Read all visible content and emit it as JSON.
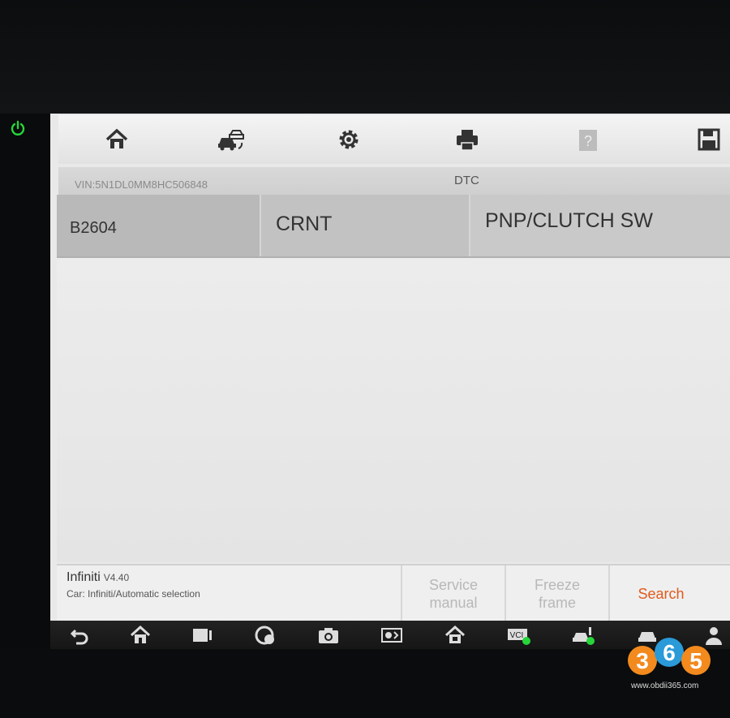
{
  "toolbar": {
    "icons": [
      "home-icon",
      "vehicle-swap-icon",
      "gear-icon",
      "printer-icon",
      "help-icon",
      "save-icon"
    ]
  },
  "info": {
    "vin": "VIN:5N1DL0MM8HC506848",
    "title": "DTC"
  },
  "dtc_rows": [
    {
      "code": "B2604",
      "status": "CRNT",
      "description": "PNP/CLUTCH SW"
    }
  ],
  "footer": {
    "make": "Infiniti",
    "version": "V4.40",
    "car_selection": "Car: Infiniti/Automatic selection",
    "buttons": {
      "service_manual": "Service\nmanual",
      "freeze_frame": "Freeze\nframe",
      "search": "Search"
    }
  },
  "colors": {
    "accent": "#e05a1c",
    "power": "#27d63a",
    "disabled": "#b8b8b8"
  },
  "watermark": {
    "digits": "365",
    "site": "www.obdii365.com"
  }
}
